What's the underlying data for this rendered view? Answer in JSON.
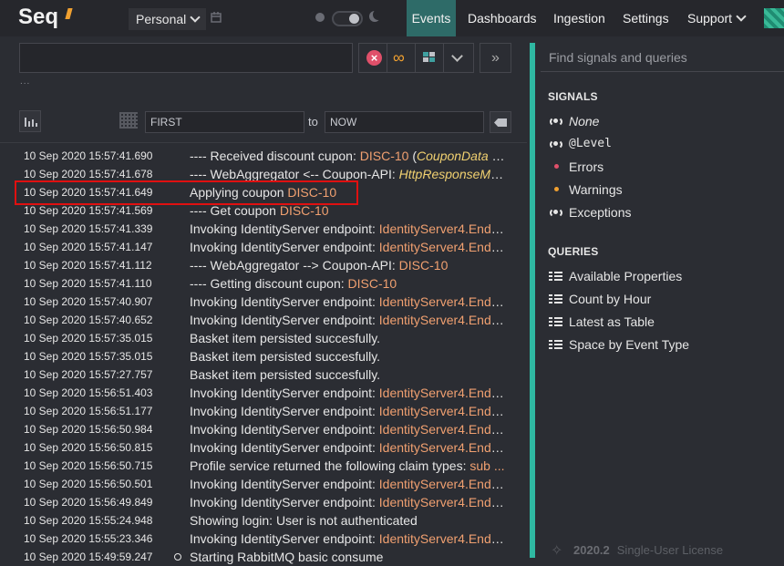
{
  "nav": {
    "logo": "Seq",
    "workspace": "Personal",
    "items": [
      "Events",
      "Dashboards",
      "Ingestion",
      "Settings",
      "Support"
    ],
    "active": "Events"
  },
  "search": {
    "placeholder": "",
    "range_from_placeholder": "FIRST",
    "range_to_label": "to",
    "range_to_placeholder": "NOW",
    "ellipsis": "..."
  },
  "events": [
    {
      "ts": "10 Sep 2020  15:57:41.690",
      "parts": [
        {
          "t": "---- Received discount cupon: "
        },
        {
          "t": "DISC-10",
          "c": "prop"
        },
        {
          "t": " ("
        },
        {
          "t": "CouponData",
          "c": "type"
        },
        {
          "t": " {\"..."
        }
      ]
    },
    {
      "ts": "10 Sep 2020  15:57:41.678",
      "parts": [
        {
          "t": "---- WebAggregator <-- Coupon-API: "
        },
        {
          "t": "HttpResponseMes...",
          "c": "type"
        }
      ]
    },
    {
      "ts": "10 Sep 2020  15:57:41.649",
      "parts": [
        {
          "t": "Applying coupon "
        },
        {
          "t": "DISC-10",
          "c": "prop"
        }
      ]
    },
    {
      "ts": "10 Sep 2020  15:57:41.569",
      "parts": [
        {
          "t": "---- Get coupon "
        },
        {
          "t": "DISC-10",
          "c": "prop"
        }
      ]
    },
    {
      "ts": "10 Sep 2020  15:57:41.339",
      "parts": [
        {
          "t": "Invoking IdentityServer endpoint: "
        },
        {
          "t": "IdentityServer4.Endp...",
          "c": "prop"
        }
      ]
    },
    {
      "ts": "10 Sep 2020  15:57:41.147",
      "parts": [
        {
          "t": "Invoking IdentityServer endpoint: "
        },
        {
          "t": "IdentityServer4.Endp...",
          "c": "prop"
        }
      ]
    },
    {
      "ts": "10 Sep 2020  15:57:41.112",
      "parts": [
        {
          "t": "---- WebAggregator --> Coupon-API: "
        },
        {
          "t": "DISC-10",
          "c": "prop"
        }
      ]
    },
    {
      "ts": "10 Sep 2020  15:57:41.110",
      "parts": [
        {
          "t": "---- Getting discount cupon: "
        },
        {
          "t": "DISC-10",
          "c": "prop"
        }
      ]
    },
    {
      "ts": "10 Sep 2020  15:57:40.907",
      "parts": [
        {
          "t": "Invoking IdentityServer endpoint: "
        },
        {
          "t": "IdentityServer4.Endp...",
          "c": "prop"
        }
      ]
    },
    {
      "ts": "10 Sep 2020  15:57:40.652",
      "parts": [
        {
          "t": "Invoking IdentityServer endpoint: "
        },
        {
          "t": "IdentityServer4.Endp...",
          "c": "prop"
        }
      ]
    },
    {
      "ts": "10 Sep 2020  15:57:35.015",
      "parts": [
        {
          "t": "Basket item persisted succesfully."
        }
      ]
    },
    {
      "ts": "10 Sep 2020  15:57:35.015",
      "parts": [
        {
          "t": "Basket item persisted succesfully."
        }
      ]
    },
    {
      "ts": "10 Sep 2020  15:57:27.757",
      "parts": [
        {
          "t": "Basket item persisted succesfully."
        }
      ]
    },
    {
      "ts": "10 Sep 2020  15:56:51.403",
      "parts": [
        {
          "t": "Invoking IdentityServer endpoint: "
        },
        {
          "t": "IdentityServer4.Endp...",
          "c": "prop"
        }
      ]
    },
    {
      "ts": "10 Sep 2020  15:56:51.177",
      "parts": [
        {
          "t": "Invoking IdentityServer endpoint: "
        },
        {
          "t": "IdentityServer4.Endp...",
          "c": "prop"
        }
      ]
    },
    {
      "ts": "10 Sep 2020  15:56:50.984",
      "parts": [
        {
          "t": "Invoking IdentityServer endpoint: "
        },
        {
          "t": "IdentityServer4.Endp...",
          "c": "prop"
        }
      ]
    },
    {
      "ts": "10 Sep 2020  15:56:50.815",
      "parts": [
        {
          "t": "Invoking IdentityServer endpoint: "
        },
        {
          "t": "IdentityServer4.Endp...",
          "c": "prop"
        }
      ]
    },
    {
      "ts": "10 Sep 2020  15:56:50.715",
      "parts": [
        {
          "t": "Profile service returned the following claim types: "
        },
        {
          "t": "sub ...",
          "c": "prop"
        }
      ]
    },
    {
      "ts": "10 Sep 2020  15:56:50.501",
      "parts": [
        {
          "t": "Invoking IdentityServer endpoint: "
        },
        {
          "t": "IdentityServer4.Endp...",
          "c": "prop"
        }
      ]
    },
    {
      "ts": "10 Sep 2020  15:56:49.849",
      "parts": [
        {
          "t": "Invoking IdentityServer endpoint: "
        },
        {
          "t": "IdentityServer4.Endp...",
          "c": "prop"
        }
      ]
    },
    {
      "ts": "10 Sep 2020  15:55:24.948",
      "parts": [
        {
          "t": "Showing login: User is not authenticated"
        }
      ]
    },
    {
      "ts": "10 Sep 2020  15:55:23.346",
      "parts": [
        {
          "t": "Invoking IdentityServer endpoint: "
        },
        {
          "t": "IdentityServer4.Endp...",
          "c": "prop"
        }
      ]
    },
    {
      "ts": "10 Sep 2020  15:49:59.247",
      "marker": true,
      "parts": [
        {
          "t": "Starting RabbitMQ basic consume"
        }
      ]
    }
  ],
  "sidebar": {
    "find_placeholder": "Find signals and queries",
    "signals_heading": "SIGNALS",
    "signals": [
      {
        "label": "None",
        "icon": "broadcast-icon",
        "italic": true
      },
      {
        "label": "@Level",
        "icon": "broadcast-icon",
        "mono": true
      },
      {
        "label": "Errors",
        "icon": "dot-icon",
        "color": "#e0506a"
      },
      {
        "label": "Warnings",
        "icon": "dot-icon",
        "color": "#f0a030"
      },
      {
        "label": "Exceptions",
        "icon": "broadcast-icon"
      }
    ],
    "queries_heading": "QUERIES",
    "queries": [
      "Available Properties",
      "Count by Hour",
      "Latest as Table",
      "Space by Event Type"
    ],
    "version": "2020.2",
    "license": "Single-User License"
  },
  "colors": {
    "accent": "#2fb8a2",
    "nav_active": "#2e6b68",
    "property": "#f0a070",
    "type": "#f0d070",
    "highlight": "#e01010"
  }
}
